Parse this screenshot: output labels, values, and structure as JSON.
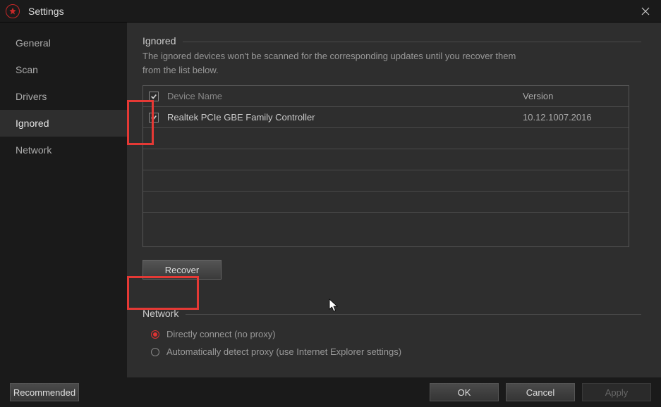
{
  "window": {
    "title": "Settings"
  },
  "sidebar": {
    "items": [
      {
        "label": "General"
      },
      {
        "label": "Scan"
      },
      {
        "label": "Drivers"
      },
      {
        "label": "Ignored"
      },
      {
        "label": "Network"
      }
    ],
    "active_index": 3
  },
  "ignored": {
    "title": "Ignored",
    "description_line1": "The ignored devices won't be scanned for the corresponding updates until you recover them",
    "description_line2": "from the list below.",
    "columns": {
      "name": "Device Name",
      "version": "Version"
    },
    "rows": [
      {
        "name": "Realtek PCIe GBE Family Controller",
        "version": "10.12.1007.2016",
        "checked": true
      }
    ],
    "header_checked": true,
    "recover_label": "Recover"
  },
  "network": {
    "title": "Network",
    "option_direct": "Directly connect (no proxy)",
    "option_auto": "Automatically detect proxy (use Internet Explorer settings)",
    "selected": "direct"
  },
  "footer": {
    "recommended": "Recommended",
    "ok": "OK",
    "cancel": "Cancel",
    "apply": "Apply"
  }
}
